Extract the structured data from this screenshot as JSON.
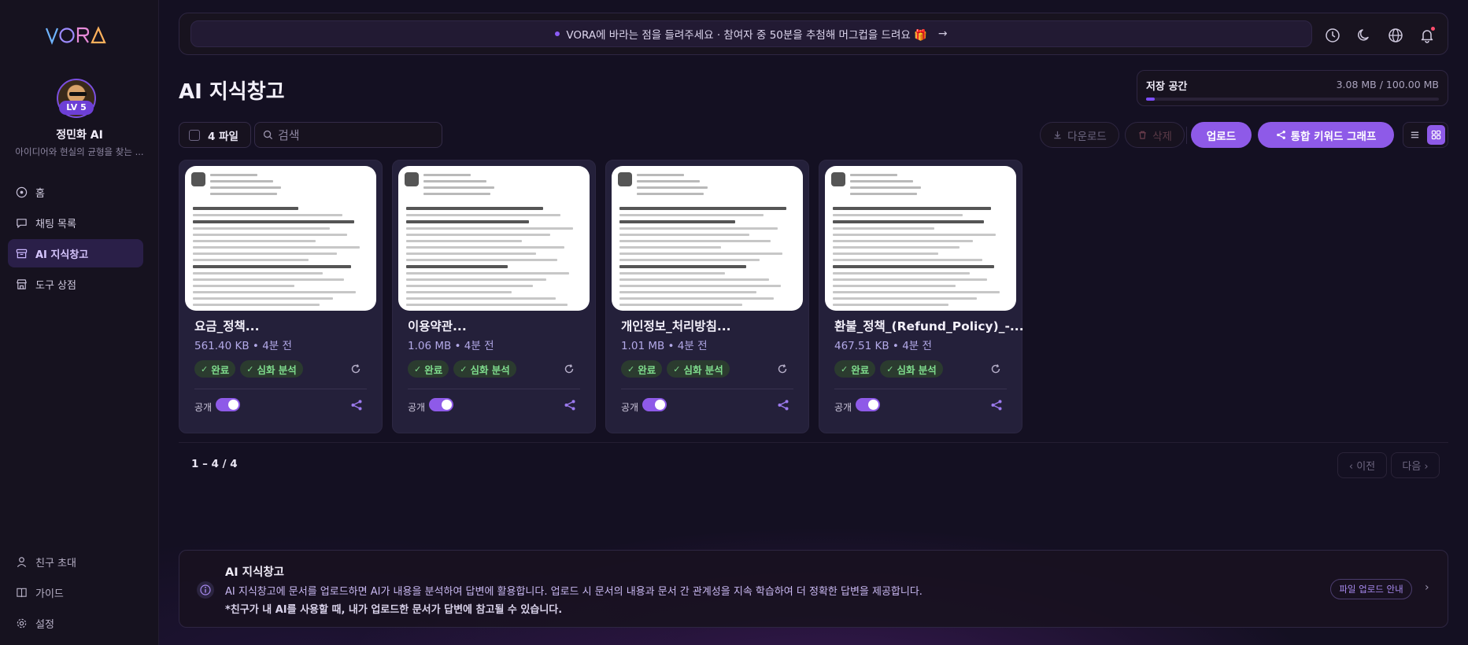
{
  "app": {
    "logo_text": "VORA",
    "accent_color": "#8e5ae8"
  },
  "profile": {
    "level": "LV 5",
    "name": "정민화 AI",
    "description": "아이디어와 현실의 균형을 찾는 ..."
  },
  "sidebar": {
    "items": [
      {
        "label": "홈",
        "icon": "home-icon"
      },
      {
        "label": "채팅 목록",
        "icon": "chat-icon"
      },
      {
        "label": "AI 지식창고",
        "icon": "archive-icon",
        "active": true
      },
      {
        "label": "도구 상점",
        "icon": "store-icon"
      }
    ],
    "bottom_items": [
      {
        "label": "친구 초대",
        "icon": "user-icon"
      },
      {
        "label": "가이드",
        "icon": "book-icon"
      },
      {
        "label": "설정",
        "icon": "gear-icon"
      }
    ]
  },
  "banner": {
    "text": "VORA에 바라는 점을 들려주세요 · 참여자 중 50분을 추첨해 머그컵을 드려요 🎁",
    "arrow": "→"
  },
  "header": {
    "title": "AI 지식창고"
  },
  "storage": {
    "label": "저장 공간",
    "value": "3.08 MB / 100.00 MB",
    "used_fraction": 0.0308
  },
  "toolbar": {
    "file_count": "4 파일",
    "search_placeholder": "검색",
    "download_label": "다운로드",
    "delete_label": "삭제",
    "upload_label": "업로드",
    "graph_label": "통합 키워드 그래프"
  },
  "files": [
    {
      "title": "요금_정책...",
      "meta": "561.40 KB • 4분 전",
      "tag_done": "완료",
      "tag_analysis": "심화 분석",
      "public_label": "공개"
    },
    {
      "title": "이용약관...",
      "meta": "1.06 MB • 4분 전",
      "tag_done": "완료",
      "tag_analysis": "심화 분석",
      "public_label": "공개"
    },
    {
      "title": "개인정보_처리방침...",
      "meta": "1.01 MB • 4분 전",
      "tag_done": "완료",
      "tag_analysis": "심화 분석",
      "public_label": "공개"
    },
    {
      "title": "환불_정책_(Refund_Policy)_-...",
      "meta": "467.51 KB • 4분 전",
      "tag_done": "완료",
      "tag_analysis": "심화 분석",
      "public_label": "공개"
    }
  ],
  "pagination": {
    "info": "1 – 4 / 4",
    "prev": "‹ 이전",
    "next": "다음 ›"
  },
  "info": {
    "title": "AI 지식창고",
    "text": "AI 지식창고에 문서를 업로드하면 AI가 내용을 분석하여 답변에 활용합니다. 업로드 시 문서의 내용과 문서 간 관계성을 지속 학습하여 더 정확한 답변을 제공합니다.",
    "note": "*친구가 내 AI를 사용할 때, 내가 업로드한 문서가 답변에 참고될 수 있습니다.",
    "guide_button": "파일 업로드 안내",
    "chevron": "›"
  }
}
